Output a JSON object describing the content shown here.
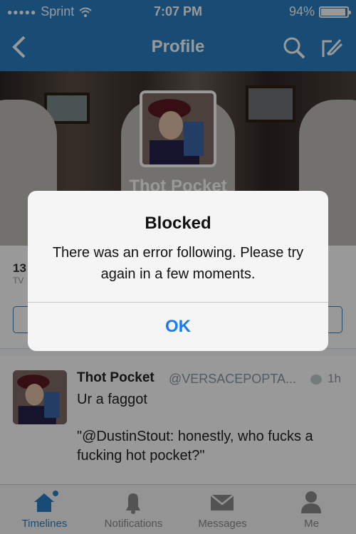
{
  "status_bar": {
    "carrier": "Sprint",
    "time": "7:07 PM",
    "battery": "94%",
    "battery_level": 0.94
  },
  "nav": {
    "title": "Profile",
    "back_icon": "chevron-left-icon",
    "search_icon": "search-icon",
    "compose_icon": "compose-icon"
  },
  "profile": {
    "name": "Thot Pocket",
    "stat_number": "13",
    "stat_label": "TV"
  },
  "tweet": {
    "name": "Thot Pocket",
    "handle": "@VERSACEPOPTA...",
    "time": "1h",
    "text": "Ur a faggot",
    "quote": "\"@DustinStout: honestly, who fucks a fucking hot pocket?\""
  },
  "alert": {
    "title": "Blocked",
    "message": "There was an error following. Please try again in a few moments.",
    "button": "OK"
  },
  "tabs": [
    {
      "label": "Timelines",
      "icon": "home-icon",
      "active": true
    },
    {
      "label": "Notifications",
      "icon": "bell-icon",
      "active": false
    },
    {
      "label": "Messages",
      "icon": "envelope-icon",
      "active": false
    },
    {
      "label": "Me",
      "icon": "person-icon",
      "active": false
    }
  ],
  "colors": {
    "brand": "#2a7fc4",
    "alert_button": "#1a7cf5"
  }
}
